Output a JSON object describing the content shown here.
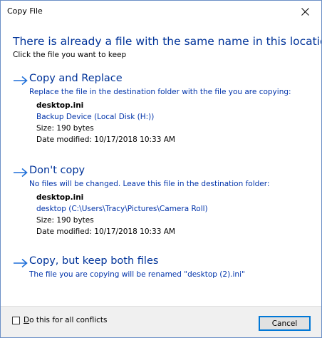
{
  "window": {
    "title": "Copy File",
    "close_icon": "close-icon"
  },
  "dialog": {
    "heading": "There is already a file with the same name in this location.",
    "subheading": "Click the file you want to keep"
  },
  "options": [
    {
      "title": "Copy and Replace",
      "description": "Replace the file in the destination folder with the file you are copying:",
      "file": {
        "name": "desktop.ini",
        "location": "Backup Device (Local Disk (H:))",
        "size": "Size: 190 bytes",
        "modified": "Date modified: 10/17/2018 10:33 AM"
      }
    },
    {
      "title": "Don't copy",
      "description": "No files will be changed. Leave this file in the destination folder:",
      "file": {
        "name": "desktop.ini",
        "location": "desktop (C:\\Users\\Tracy\\Pictures\\Camera Roll)",
        "size": "Size: 190 bytes",
        "modified": "Date modified: 10/17/2018 10:33 AM"
      }
    },
    {
      "title": "Copy, but keep both files",
      "description": "The file you are copying will be renamed \"desktop (2).ini\""
    }
  ],
  "footer": {
    "checkbox_label_underlined": "D",
    "checkbox_label_rest": "o this for all conflicts",
    "checkbox_checked": false,
    "cancel_label": "Cancel"
  },
  "colors": {
    "accent_blue": "#003399",
    "link_blue": "#0033aa",
    "focus_border": "#0078d7"
  }
}
